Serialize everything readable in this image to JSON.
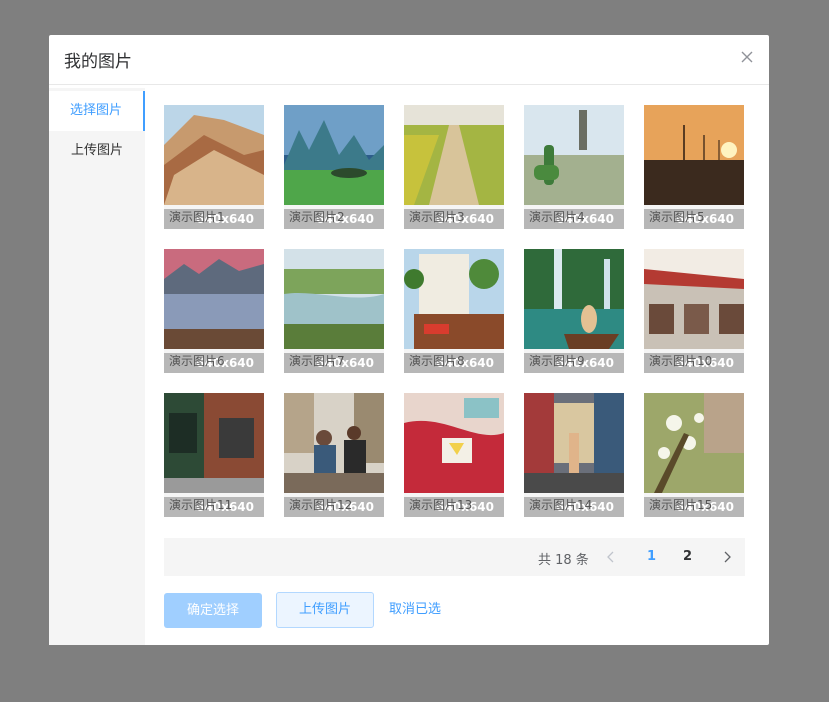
{
  "dialog": {
    "title": "我的图片"
  },
  "menu": {
    "items": [
      {
        "label": "选择图片",
        "active": true
      },
      {
        "label": "上传图片",
        "active": false
      }
    ]
  },
  "images": [
    {
      "size": "640x640",
      "name": "演示图片1"
    },
    {
      "size": "640x640",
      "name": "演示图片2"
    },
    {
      "size": "640x640",
      "name": "演示图片3"
    },
    {
      "size": "640x640",
      "name": "演示图片4"
    },
    {
      "size": "640x640",
      "name": "演示图片5"
    },
    {
      "size": "640x640",
      "name": "演示图片6"
    },
    {
      "size": "640x640",
      "name": "演示图片7"
    },
    {
      "size": "640x640",
      "name": "演示图片8"
    },
    {
      "size": "640x640",
      "name": "演示图片9"
    },
    {
      "size": "640x640",
      "name": "演示图片10"
    },
    {
      "size": "640x640",
      "name": "演示图片11"
    },
    {
      "size": "640x640",
      "name": "演示图片12"
    },
    {
      "size": "640x640",
      "name": "演示图片13"
    },
    {
      "size": "640x640",
      "name": "演示图片14"
    },
    {
      "size": "640x640",
      "name": "演示图片15"
    }
  ],
  "pagination": {
    "total_text": "共 18 条",
    "pages": [
      "1",
      "2"
    ],
    "current": "1"
  },
  "actions": {
    "confirm_label": "确定选择",
    "upload_label": "上传图片",
    "cancel_label": "取消已选"
  },
  "colors": {
    "accent": "#409eff",
    "confirm_disabled": "#a0cfff",
    "backdrop": "#7f7f7f"
  }
}
